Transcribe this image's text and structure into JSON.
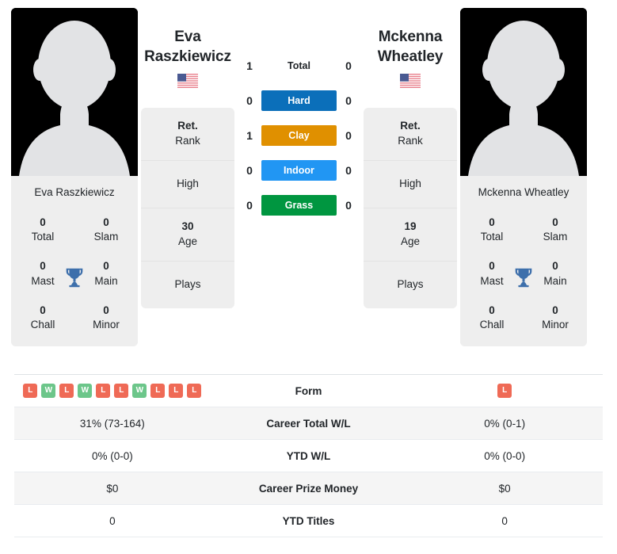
{
  "players": {
    "left": {
      "first_name": "Eva",
      "last_name": "Raszkiewicz",
      "full_name": "Eva Raszkiewicz",
      "country": "United States",
      "avatar": "player-photo-placeholder",
      "titles": {
        "total_value": "0",
        "total_label": "Total",
        "slam_value": "0",
        "slam_label": "Slam",
        "mast_value": "0",
        "mast_label": "Mast",
        "main_value": "0",
        "main_label": "Main",
        "chall_value": "0",
        "chall_label": "Chall",
        "minor_value": "0",
        "minor_label": "Minor"
      },
      "stats": {
        "rank_value": "Ret.",
        "rank_label": "Rank",
        "high_value": "",
        "high_label": "High",
        "age_value": "30",
        "age_label": "Age",
        "plays_value": "",
        "plays_label": "Plays"
      }
    },
    "right": {
      "first_name": "Mckenna",
      "last_name": "Wheatley",
      "full_name": "Mckenna Wheatley",
      "country": "United States",
      "avatar": "player-photo-placeholder",
      "titles": {
        "total_value": "0",
        "total_label": "Total",
        "slam_value": "0",
        "slam_label": "Slam",
        "mast_value": "0",
        "mast_label": "Mast",
        "main_value": "0",
        "main_label": "Main",
        "chall_value": "0",
        "chall_label": "Chall",
        "minor_value": "0",
        "minor_label": "Minor"
      },
      "stats": {
        "rank_value": "Ret.",
        "rank_label": "Rank",
        "high_value": "",
        "high_label": "High",
        "age_value": "19",
        "age_label": "Age",
        "plays_value": "",
        "plays_label": "Plays"
      }
    }
  },
  "head_to_head": {
    "rows": [
      {
        "label": "Total",
        "left": "1",
        "right": "0",
        "color": "transparent",
        "plain": true
      },
      {
        "label": "Hard",
        "left": "0",
        "right": "0",
        "color": "#0b6fba",
        "plain": false
      },
      {
        "label": "Clay",
        "left": "1",
        "right": "0",
        "color": "#e09000",
        "plain": false
      },
      {
        "label": "Indoor",
        "left": "0",
        "right": "0",
        "color": "#2196f3",
        "plain": false
      },
      {
        "label": "Grass",
        "left": "0",
        "right": "0",
        "color": "#009640",
        "plain": false
      }
    ]
  },
  "comparison_table": {
    "rows": [
      {
        "label": "Form",
        "type": "form",
        "left_form": [
          "L",
          "W",
          "L",
          "W",
          "L",
          "L",
          "W",
          "L",
          "L",
          "L"
        ],
        "right_form": [
          "L"
        ],
        "left": "",
        "right": ""
      },
      {
        "label": "Career Total W/L",
        "type": "text",
        "left": "31% (73-164)",
        "right": "0% (0-1)"
      },
      {
        "label": "YTD W/L",
        "type": "text",
        "left": "0% (0-0)",
        "right": "0% (0-0)"
      },
      {
        "label": "Career Prize Money",
        "type": "text",
        "left": "$0",
        "right": "$0"
      },
      {
        "label": "YTD Titles",
        "type": "text",
        "left": "0",
        "right": "0"
      }
    ]
  },
  "colors": {
    "win_badge": "#ec6b5e",
    "loss_badge": "#ec6b5e",
    "form_win": "#6cc68a",
    "form_loss": "#ef6a56",
    "trophy": "#3d6fab",
    "card_bg": "#eeeeee",
    "row_alt_bg": "#f5f5f5"
  }
}
